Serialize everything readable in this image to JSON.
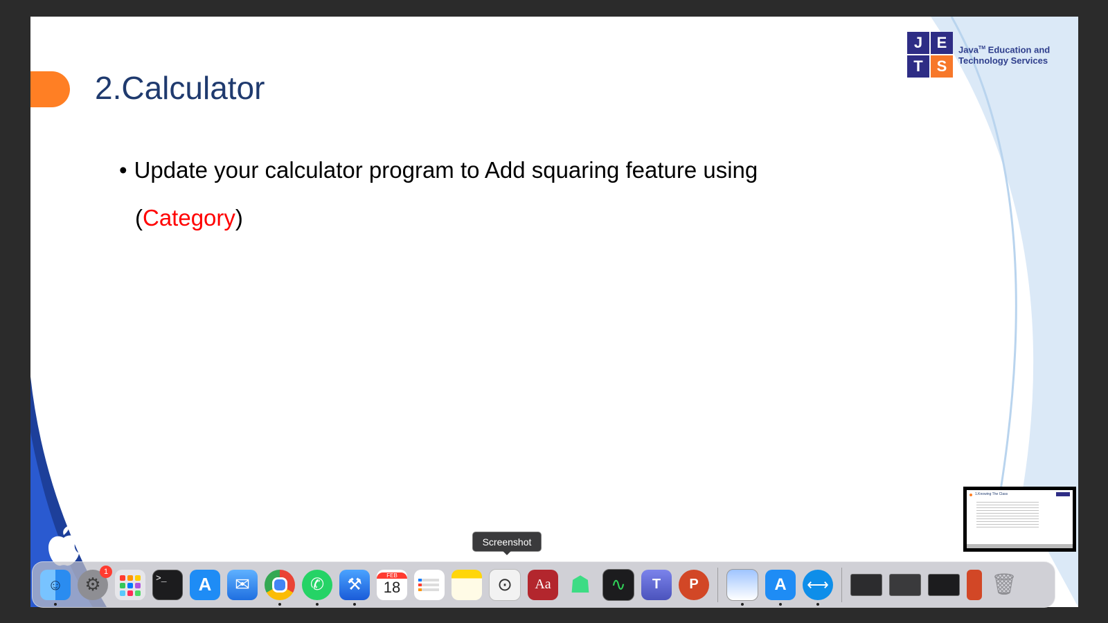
{
  "slide": {
    "title": "2.Calculator",
    "bullet_bullet": "•",
    "bullet_text": "Update your calculator program to Add squaring feature using",
    "bullet_cont_open": "(",
    "bullet_highlight": "Category",
    "bullet_cont_close": ")",
    "accent_color": "#ff7f24",
    "highlight_color": "#ff0000"
  },
  "logo": {
    "letters": [
      "J",
      "E",
      "T",
      "S"
    ],
    "line1": "Java",
    "line1_tm": "TM",
    "line1_rest": " Education and",
    "line2": "Technology Services"
  },
  "tooltip": {
    "label": "Screenshot"
  },
  "dock": {
    "items": [
      {
        "name": "Finder",
        "icon": "finder-icon"
      },
      {
        "name": "System Settings",
        "icon": "settings-gear-icon",
        "badge": "1"
      },
      {
        "name": "Launchpad",
        "icon": "launchpad-grid-icon"
      },
      {
        "name": "Terminal",
        "icon": "terminal-icon",
        "glyph": ">_"
      },
      {
        "name": "App Store",
        "icon": "app-store-icon",
        "glyph": "A"
      },
      {
        "name": "Mail",
        "icon": "mail-icon",
        "glyph": "✉"
      },
      {
        "name": "Chrome",
        "icon": "chrome-icon"
      },
      {
        "name": "WhatsApp",
        "icon": "whatsapp-icon",
        "glyph": "✆"
      },
      {
        "name": "Xcode",
        "icon": "xcode-icon",
        "glyph": "⚒"
      },
      {
        "name": "Calendar",
        "icon": "calendar-icon",
        "month": "FEB",
        "day": "18"
      },
      {
        "name": "Reminders",
        "icon": "reminders-icon"
      },
      {
        "name": "Notes",
        "icon": "notes-icon"
      },
      {
        "name": "Screenshot",
        "icon": "camera-icon",
        "glyph": "⊙"
      },
      {
        "name": "Dictionary",
        "icon": "dictionary-icon",
        "glyph": "Aa"
      },
      {
        "name": "Android Studio",
        "icon": "android-icon",
        "glyph": "☗"
      },
      {
        "name": "Activity Monitor",
        "icon": "activity-monitor-icon",
        "glyph": "∿"
      },
      {
        "name": "Teams",
        "icon": "teams-icon",
        "glyph": "T"
      },
      {
        "name": "PowerPoint",
        "icon": "powerpoint-icon",
        "glyph": "P"
      },
      {
        "name": "Preview",
        "icon": "preview-icon"
      },
      {
        "name": "Simulator",
        "icon": "simulator-icon",
        "glyph": "A"
      },
      {
        "name": "TeamViewer",
        "icon": "teamviewer-icon",
        "glyph": "⟷"
      },
      {
        "name": "Window 1",
        "icon": "window-thumbnail-icon"
      },
      {
        "name": "Window 2",
        "icon": "window-thumbnail-icon"
      },
      {
        "name": "Window 3",
        "icon": "window-thumbnail-icon"
      },
      {
        "name": "Window 4",
        "icon": "phone-thumbnail-icon"
      },
      {
        "name": "Trash",
        "icon": "trash-icon",
        "glyph": "🗑"
      }
    ]
  },
  "thumbnail": {
    "title": "1.Knowing The Class"
  }
}
